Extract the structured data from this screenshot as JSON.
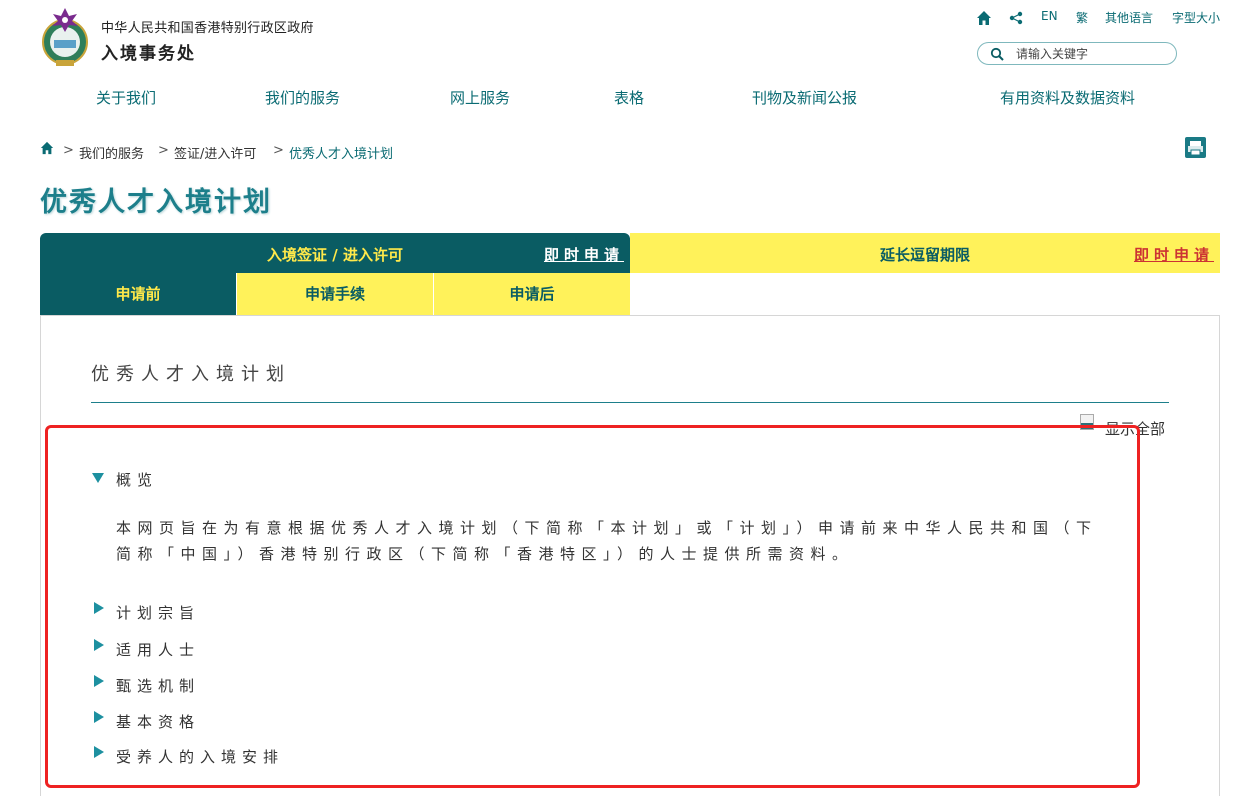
{
  "header": {
    "gov_name": "中华人民共和国香港特别行政区政府",
    "dept_name": "入境事务处",
    "utilities": {
      "en": "EN",
      "traditional": "繁",
      "other_lang": "其他语言",
      "font_size": "字型大小"
    },
    "search": {
      "placeholder": "请输入关键字"
    }
  },
  "nav": [
    "关于我们",
    "我们的服务",
    "网上服务",
    "表格",
    "刊物及新闻公报",
    "有用资料及数据资料"
  ],
  "breadcrumb": [
    "我们的服务",
    "签证/进入许可",
    "优秀人才入境计划"
  ],
  "page_title": "优秀人才入境计划",
  "tabs": {
    "left": {
      "label": "入境签证 / 进入许可",
      "apply": "即时申请"
    },
    "right": {
      "label": "延长逗留期限",
      "apply": "即时申请"
    },
    "sub": [
      "申请前",
      "申请手续",
      "申请后"
    ]
  },
  "content": {
    "section_title": "优秀人才入境计划",
    "show_all": "显示全部",
    "overview": {
      "title": "概览",
      "text": "本网页旨在为有意根据优秀人才入境计划（下简称「本计划」或「计划」）申请前来中华人民共和国（下简称「中国」）香港特别行政区（下简称「香港特区」）的人士提供所需资料。"
    },
    "items": [
      "计划宗旨",
      "适用人士",
      "甄选机制",
      "基本资格",
      "受养人的入境安排"
    ]
  },
  "colors": {
    "teal": "#0a5c63",
    "yellow": "#fff25a",
    "accent_yellow_text": "#ffe94a",
    "highlight_red": "#ee2222"
  }
}
